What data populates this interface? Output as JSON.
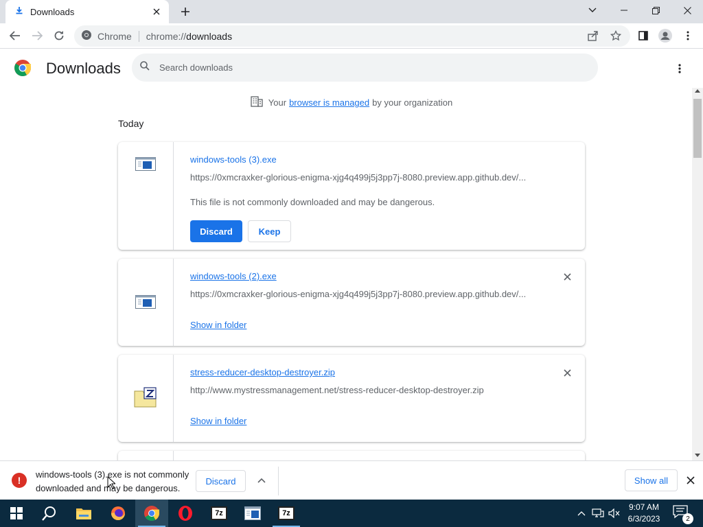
{
  "tab": {
    "title": "Downloads"
  },
  "omnibox": {
    "chip_label": "Chrome",
    "url_prefix": "chrome://",
    "url_path": "downloads"
  },
  "page": {
    "title": "Downloads",
    "search_placeholder": "Search downloads",
    "managed_prefix": "Your",
    "managed_link": "browser is managed",
    "managed_suffix": "by your organization",
    "section_date": "Today"
  },
  "downloads": [
    {
      "name": "windows-tools (3).exe",
      "url": "https://0xmcraxker-glorious-enigma-xjg4q499j5j3pp7j-8080.preview.app.github.dev/...",
      "warning": "This file is not commonly downloaded and may be dangerous.",
      "discard_label": "Discard",
      "keep_label": "Keep"
    },
    {
      "name": "windows-tools (2).exe",
      "url": "https://0xmcraxker-glorious-enigma-xjg4q499j5j3pp7j-8080.preview.app.github.dev/...",
      "action_label": "Show in folder"
    },
    {
      "name": "stress-reducer-desktop-destroyer.zip",
      "url": "http://www.mystressmanagement.net/stress-reducer-desktop-destroyer.zip",
      "action_label": "Show in folder"
    }
  ],
  "shelf": {
    "message": "windows-tools (3).exe is not commonly downloaded and may be dangerous.",
    "discard_label": "Discard",
    "show_all_label": "Show all"
  },
  "taskbar": {
    "time": "9:07 AM",
    "date": "6/3/2023",
    "notification_count": "2",
    "sevenzip_label": "7z",
    "sevenzip_label_2": "7z"
  },
  "colors": {
    "accent": "#1a73e8",
    "error": "#d93025",
    "taskbar": "#0b2a3f",
    "tabstrip": "#dee1e6"
  },
  "icons": {
    "tab": "download-icon",
    "file_exe": "exe-file-icon",
    "file_zip": "zip-file-icon"
  }
}
